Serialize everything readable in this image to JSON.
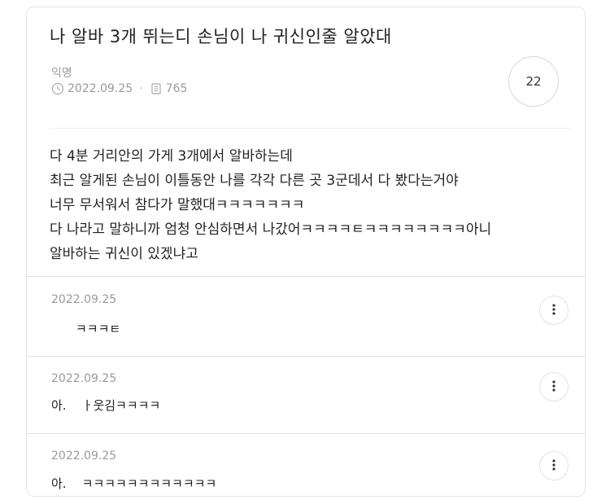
{
  "post": {
    "title": "나 알바 3개 뛰는디 손님이 나 귀신인줄 알았대",
    "author": "익명",
    "date": "2022.09.25",
    "views": "765",
    "comment_count": "22",
    "body_lines": [
      "다 4분 거리안의 가게 3개에서 알바하는데",
      "최근 알게된 손님이 이틀동안 나를 각각 다른 곳 3군데서 다 봤다는거야",
      "너무 무서워서 참다가 말했대ㅋㅋㅋㅋㅋㅋㅋ",
      "다 나라고 말하니까 엄청 안심하면서 나갔어ㅋㅋㅋㅋㅌㅋㅋㅋㅋㅋㅋㅋㅋ아니",
      "알바하는 귀신이 있겠냐고"
    ]
  },
  "comments": [
    {
      "date": "2022.09.25",
      "text": "ㅋㅋㅋㅌ"
    },
    {
      "date": "2022.09.25",
      "text": "아.    ㅏ웃김ㅋㅋㅋㅋ"
    },
    {
      "date": "2022.09.25",
      "text": "아.    ㅋㅋㅋㅋㅋㅋㅋㅋㅋㅋㅋㅋ"
    }
  ],
  "icons": {
    "date": "clock-icon",
    "views": "document-icon",
    "more": "more-vertical-icon"
  }
}
